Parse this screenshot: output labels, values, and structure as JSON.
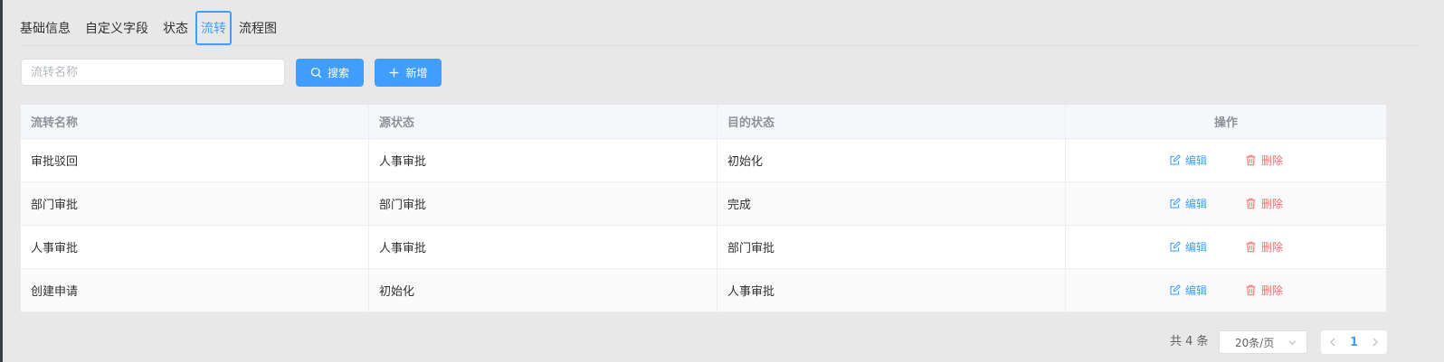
{
  "tabs": [
    {
      "label": "基础信息"
    },
    {
      "label": "自定义字段"
    },
    {
      "label": "状态"
    },
    {
      "label": "流转"
    },
    {
      "label": "流程图"
    }
  ],
  "search": {
    "placeholder": "流转名称",
    "search_label": "搜索",
    "add_label": "新增"
  },
  "table": {
    "columns": [
      "流转名称",
      "源状态",
      "目的状态",
      "操作"
    ],
    "rows": [
      {
        "name": "审批驳回",
        "source": "人事审批",
        "target": "初始化"
      },
      {
        "name": "部门审批",
        "source": "部门审批",
        "target": "完成"
      },
      {
        "name": "人事审批",
        "source": "人事审批",
        "target": "部门审批"
      },
      {
        "name": "创建申请",
        "source": "初始化",
        "target": "人事审批"
      }
    ],
    "edit_label": "编辑",
    "delete_label": "删除"
  },
  "pagination": {
    "total_text": "共 4 条",
    "page_size": "20条/页",
    "current_page": "1"
  },
  "colors": {
    "primary": "#409eff",
    "danger": "#f56c6c"
  }
}
